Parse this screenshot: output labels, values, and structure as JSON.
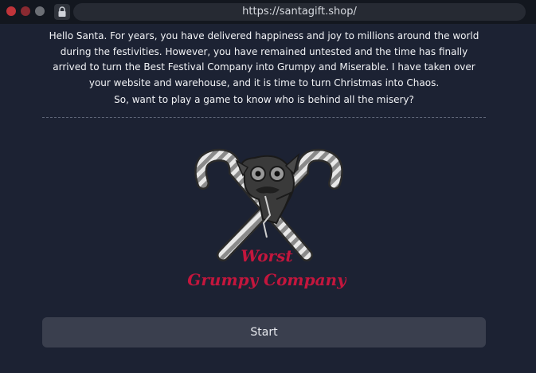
{
  "browser": {
    "url": "https://santagift.shop/"
  },
  "page": {
    "intro_text": "Hello Santa. For years, you have delivered happiness and joy to millions around the world during the festivities. However, you have remained untested and the time has finally arrived to turn the Best Festival Company into Grumpy and Miserable. I have taken over your website and warehouse, and it is time to turn Christmas into Chaos.",
    "question_text": "So, want to play a game to know who is behind all the misery?",
    "logo_text_line1": "Worst",
    "logo_text_line2": "Grumpy Company",
    "start_label": "Start"
  },
  "colors": {
    "background": "#1c2233",
    "button": "#3a3f4e",
    "logo_text": "#c4163d"
  }
}
